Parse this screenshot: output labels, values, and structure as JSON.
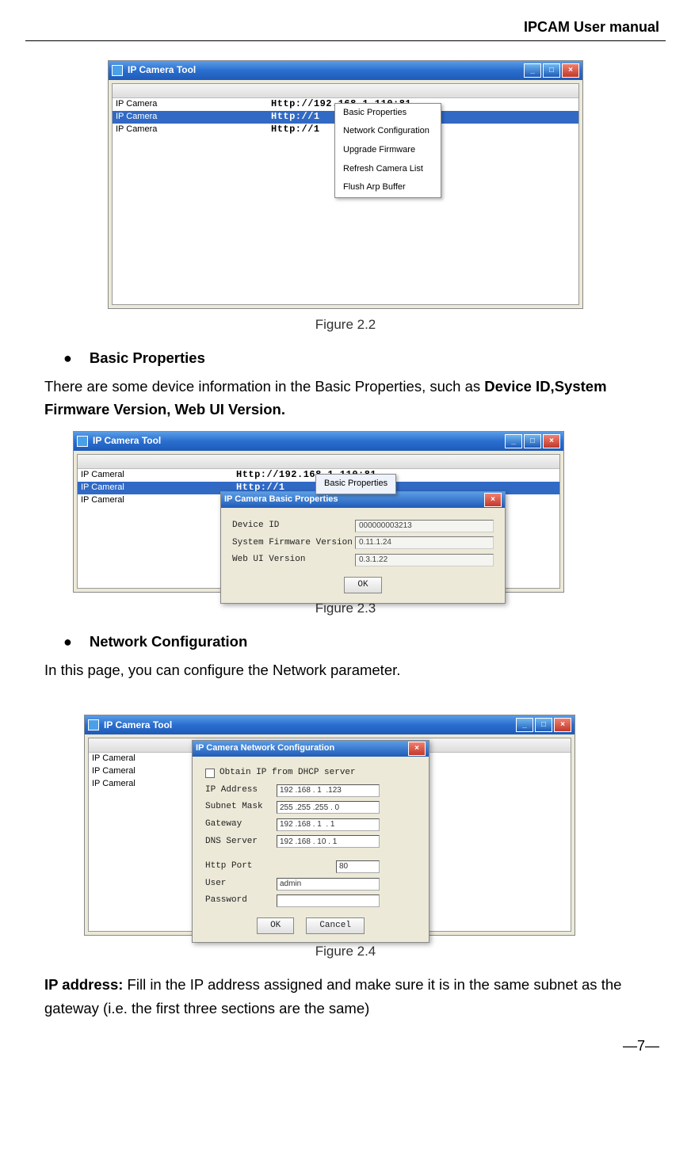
{
  "header": {
    "title": "IPCAM User manual"
  },
  "fig22": {
    "title": "IP Camera Tool",
    "rows": [
      {
        "name": "IP Camera",
        "url": "Http://192.168.1.110:81"
      },
      {
        "name": "IP Camera",
        "url": "Http://1"
      },
      {
        "name": "IP Camera",
        "url": "Http://1"
      }
    ],
    "menu": {
      "items": [
        "Basic Properties",
        "Network Configuration",
        "Upgrade Firmware",
        "Refresh Camera List",
        "Flush Arp Buffer"
      ]
    },
    "caption": "Figure 2.2"
  },
  "sec_basic": {
    "heading": "Basic Properties",
    "text_prefix": "There are some device information in the Basic Properties, such as ",
    "text_bold": "Device ID,System Firmware Version, Web UI Version."
  },
  "fig23": {
    "title": "IP Camera Tool",
    "rows": [
      {
        "name": "IP Cameral",
        "url": "Http://192.168.1.110:81"
      },
      {
        "name": "IP Cameral",
        "url": "Http://1"
      },
      {
        "name": "IP Cameral",
        "url": "Http://1"
      }
    ],
    "tooltip": "Basic Properties",
    "dialog": {
      "title": "IP Camera  Basic Properties",
      "rows": [
        {
          "label": "Device ID",
          "value": "000000003213"
        },
        {
          "label": "System Firmware Version",
          "value": "0.11.1.24"
        },
        {
          "label": "Web UI Version",
          "value": "0.3.1.22"
        }
      ],
      "ok": "OK"
    },
    "caption": "Figure 2.3"
  },
  "sec_net": {
    "heading": "Network Configuration",
    "text": "In this page, you can configure the Network parameter."
  },
  "fig24": {
    "title": "IP Camera Tool",
    "rows": [
      "IP Cameral",
      "IP Cameral",
      "IP Cameral"
    ],
    "dialog": {
      "title": "IP Camera   Network Configuration",
      "dhcp": "Obtain IP from DHCP server",
      "rows": [
        {
          "label": "IP Address",
          "value": "192 .168 . 1  .123"
        },
        {
          "label": "Subnet Mask",
          "value": "255 .255 .255 . 0"
        },
        {
          "label": "Gateway",
          "value": "192 .168 . 1  . 1"
        },
        {
          "label": "DNS Server",
          "value": "192 .168 . 10 . 1"
        }
      ],
      "http_label": "Http Port",
      "http_value": "80",
      "user_label": "User",
      "user_value": "admin",
      "pass_label": "Password",
      "ok": "OK",
      "cancel": "Cancel"
    },
    "caption": "Figure 2.4"
  },
  "sec_ip": {
    "bold": "IP address:",
    "text": " Fill in the IP address assigned and make sure it is in the same subnet as the gateway (i.e. the first three sections are the same)"
  },
  "footer": {
    "pagenum": "—7—"
  }
}
